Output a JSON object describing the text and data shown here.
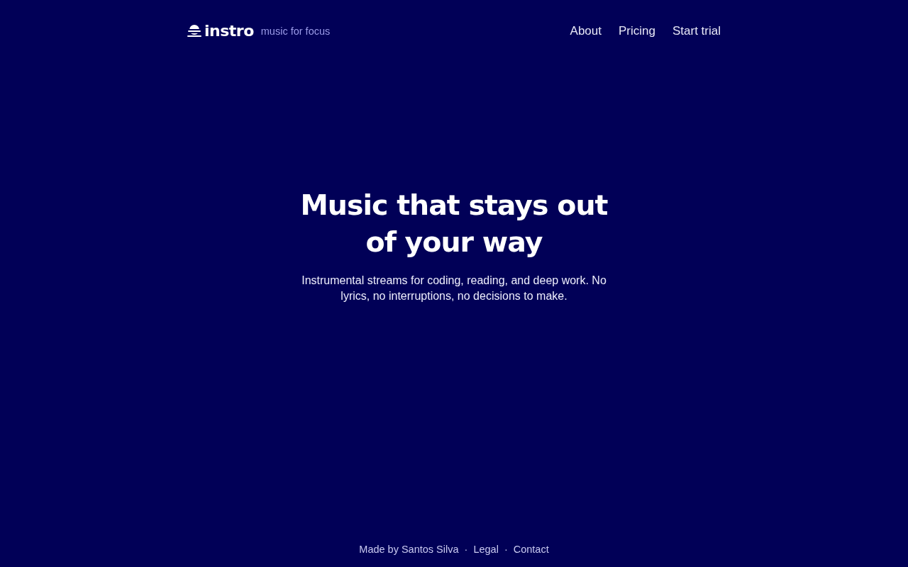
{
  "header": {
    "logo": {
      "name": "instro",
      "tagline": "music for focus"
    },
    "nav": [
      {
        "label": "About"
      },
      {
        "label": "Pricing"
      },
      {
        "label": "Start trial"
      }
    ]
  },
  "hero": {
    "title": "Music that stays out of your way",
    "subtitle": "Instrumental streams for coding, reading, and deep work. No lyrics, no interruptions, no decisions to make."
  },
  "footer": {
    "credit": "Made by Santos Silva",
    "links": [
      {
        "separator": "·",
        "label": "Legal"
      },
      {
        "separator": "·",
        "label": "Contact"
      }
    ]
  }
}
